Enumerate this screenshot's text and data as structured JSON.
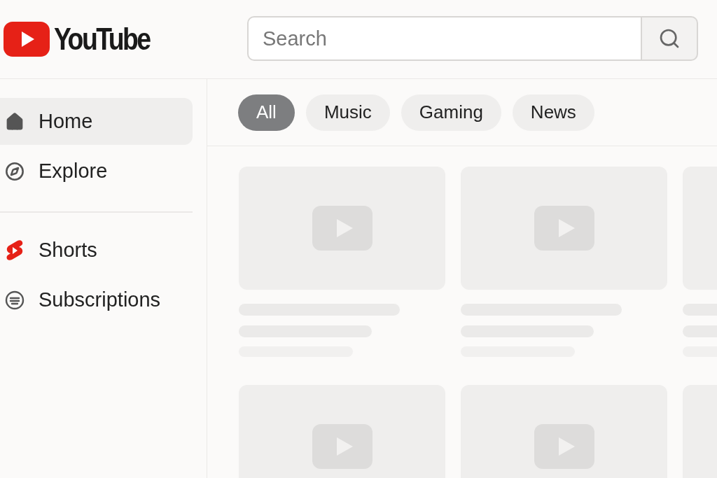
{
  "header": {
    "logo_text": "YouTube",
    "search": {
      "placeholder": "Search"
    }
  },
  "sidebar": {
    "items": [
      {
        "kind": "home",
        "label": "Home",
        "selected": true
      },
      {
        "kind": "explore",
        "label": "Explore",
        "selected": false
      },
      {
        "kind": "divider"
      },
      {
        "kind": "shorts",
        "label": "Shorts",
        "selected": false
      },
      {
        "kind": "subscriptions",
        "label": "Subscriptions",
        "selected": false
      }
    ]
  },
  "chips": [
    {
      "label": "All",
      "selected": true
    },
    {
      "label": "Music",
      "selected": false
    },
    {
      "label": "Gaming",
      "selected": false
    },
    {
      "label": "News",
      "selected": false
    }
  ]
}
